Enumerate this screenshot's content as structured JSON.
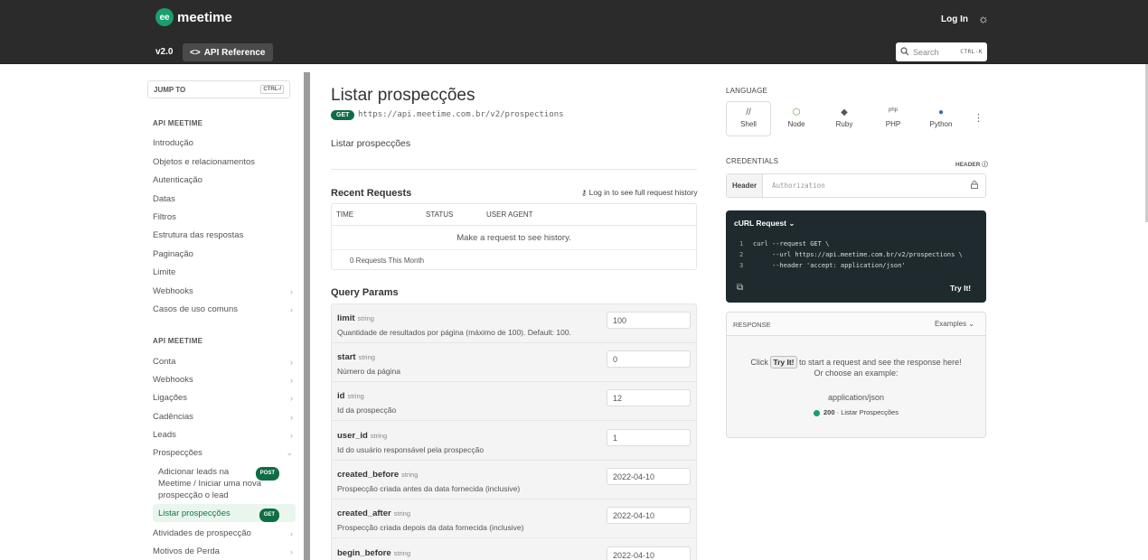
{
  "header": {
    "logo_text": "meetime",
    "login": "Log In",
    "version": "v2.0",
    "api_reference": "API Reference",
    "search_placeholder": "Search",
    "search_shortcut": "CTRL-K"
  },
  "sidebar": {
    "jump_to": "JUMP TO",
    "jump_shortcut": "CTRL-/",
    "section1_title": "API MEETIME",
    "section1_items": [
      "Introdução",
      "Objetos e relacionamentos",
      "Autenticação",
      "Datas",
      "Filtros",
      "Estrutura das respostas",
      "Paginação",
      "Limite",
      "Webhooks",
      "Casos de uso comuns"
    ],
    "section2_title": "API MEETIME",
    "section2_items": [
      "Conta",
      "Webhooks",
      "Ligações",
      "Cadências",
      "Leads",
      "Prospecções"
    ],
    "sub_items": [
      {
        "label": "Adicionar leads na Meetime / Iniciar uma nova prospecção o lead",
        "method": "POST"
      },
      {
        "label": "Listar prospecções",
        "method": "GET"
      }
    ],
    "section2_more": [
      "Atividades de prospecção",
      "Motivos de Perda"
    ]
  },
  "main": {
    "title": "Listar prospecções",
    "method": "GET",
    "url": "https://api.meetime.com.br/v2/prospections",
    "description": "Listar prospecções",
    "recent_requests": {
      "title": "Recent Requests",
      "login_link": "Log in to see full request history",
      "columns": [
        "TIME",
        "STATUS",
        "USER AGENT"
      ],
      "empty_message": "Make a request to see history.",
      "footer": "0 Requests This Month"
    },
    "query_params": {
      "title": "Query Params",
      "params": [
        {
          "name": "limit",
          "type": "string",
          "description": "Quantidade de resultados por página (máximo de 100). Default: 100.",
          "value": "100"
        },
        {
          "name": "start",
          "type": "string",
          "description": "Número da página",
          "value": "0"
        },
        {
          "name": "id",
          "type": "string",
          "description": "Id da prospecção",
          "value": "12"
        },
        {
          "name": "user_id",
          "type": "string",
          "description": "Id do usuário responsável pela prospecção",
          "value": "1"
        },
        {
          "name": "created_before",
          "type": "string",
          "description": "Prospecção criada antes da data fornecida (inclusive)",
          "value": "2022-04-10"
        },
        {
          "name": "created_after",
          "type": "string",
          "description": "Prospecção criada depois da data fornecida (inclusive)",
          "value": "2022-04-10"
        },
        {
          "name": "begin_before",
          "type": "string",
          "description": "",
          "value": "2022-04-10"
        }
      ]
    }
  },
  "right": {
    "language_label": "LANGUAGE",
    "languages": [
      "Shell",
      "Node",
      "Ruby",
      "PHP",
      "Python"
    ],
    "credentials_label": "CREDENTIALS",
    "header_label": "HEADER",
    "cred_tag": "Header",
    "cred_placeholder": "Authorization",
    "curl_title": "cURL Request",
    "curl_lines": [
      "curl --request GET \\",
      "     --url https://api.meetime.com.br/v2/prospections \\",
      "     --header 'accept: application/json'"
    ],
    "try_it": "Try It!",
    "response_label": "RESPONSE",
    "examples": "Examples",
    "resp_click": "Click",
    "resp_try": "Try It!",
    "resp_rest": "to start a request and see the response here!",
    "resp_choose": "Or choose an example:",
    "resp_type": "application/json",
    "resp_code": "200",
    "resp_example": "Listar Prospecções"
  }
}
